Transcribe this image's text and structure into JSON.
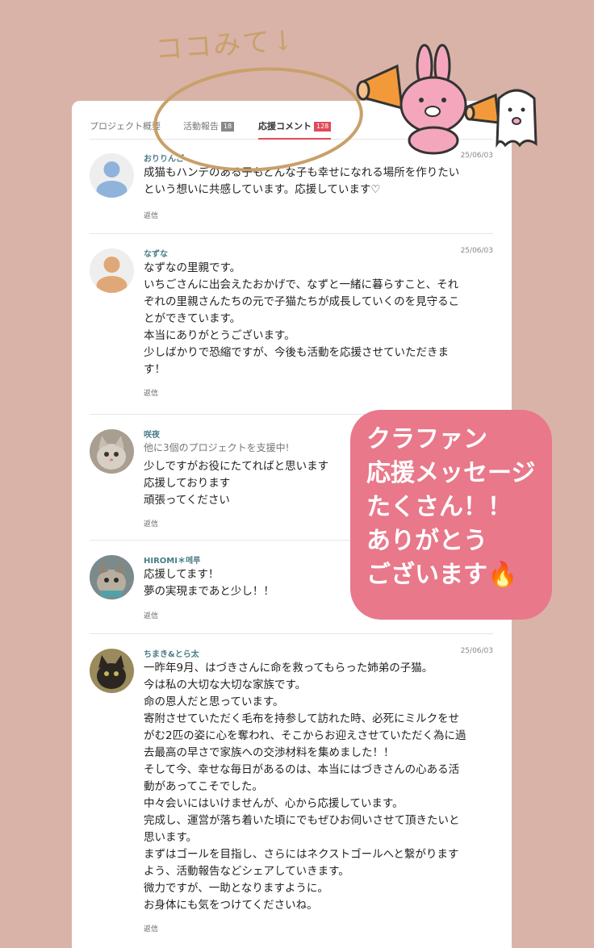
{
  "overlay": {
    "handwritten_note": "ココみて",
    "arrow": "↓",
    "message": "クラファン\n応援メッセージ\nたくさん！！\nありがとう\nございます🔥"
  },
  "tabs": [
    {
      "label": "プロジェクト概要"
    },
    {
      "label": "活動報告",
      "count": "18"
    },
    {
      "label": "応援コメント",
      "count": "128"
    }
  ],
  "comments": [
    {
      "name": "おりりんご",
      "date": "25/06/03",
      "text": "成猫もハンデのある子もどんな子も幸せになれる場所を作りたい\nという想いに共感しています。応援しています♡",
      "reply": "返信",
      "avatar": "default-blue"
    },
    {
      "name": "なずな",
      "date": "25/06/03",
      "text": "なずなの里親です。\nいちごさんに出会えたおかげで、なずと一緒に暮らすこと、それ\nぞれの里親さんたちの元で子猫たちが成長していくのを見守るこ\nとができています。\n本当にありがとうございます。\n少しばかりで恐縮ですが、今後も活動を応援させていただきま\nす！",
      "reply": "返信",
      "avatar": "default-orange"
    },
    {
      "name": "咲夜",
      "support": "他に3個のプロジェクトを支援中!",
      "text": "少しですがお役にたてればと思います\n応援しております\n頑張ってください",
      "reply": "返信",
      "avatar": "cat-photo"
    },
    {
      "name": "HIROMI＊메루",
      "text": "応援してます！\n夢の実現まであと少し！！",
      "reply": "返信",
      "avatar": "cat-photo"
    },
    {
      "name": "ちまき&とら太",
      "date": "25/06/03",
      "text": "一昨年9月、はづきさんに命を救ってもらった姉弟の子猫。\n今は私の大切な大切な家族です。\n命の恩人だと思っています。\n寄附させていただく毛布を持参して訪れた時、必死にミルクをせ\nがむ2匹の姿に心を奪われ、そこからお迎えさせていただく為に過\n去最高の早さで家族への交渉材料を集めました！！\nそして今、幸せな毎日があるのは、本当にはづきさんの心ある活\n動があってこそでした。\n中々会いにはいけませんが、心から応援しています。\n完成し、運営が落ち着いた頃にでもぜひお伺いさせて頂きたいと\n思います。\nまずはゴールを目指し、さらにはネクストゴールへと繋がります\nよう、活動報告などシェアしていきます。\n微力ですが、一助となりますように。\nお身体にも気をつけてくださいね。",
      "reply": "返信",
      "avatar": "cat-photo"
    }
  ]
}
